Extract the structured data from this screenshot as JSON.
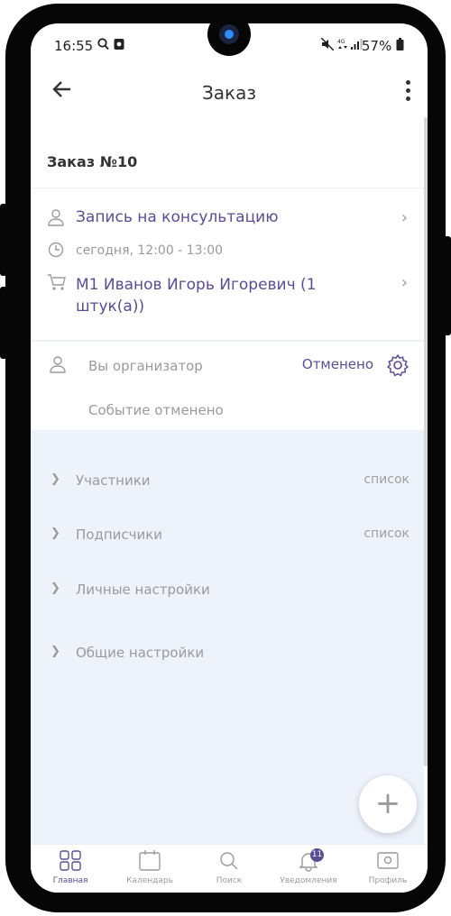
{
  "status_bar": {
    "time": "16:55",
    "battery": "57%"
  },
  "appbar": {
    "title": "Заказ"
  },
  "order": {
    "title": "Заказ №10",
    "event_name": "Запись на консультацию",
    "time": "сегодня, 12:00 - 13:00",
    "item": "М1 Иванов Игорь Игоревич (1 штук(а))"
  },
  "status": {
    "role": "Вы организатор",
    "state": "Отменено",
    "message": "Событие отменено"
  },
  "sections": [
    {
      "label": "Участники",
      "value": "список"
    },
    {
      "label": "Подписчики",
      "value": "список"
    },
    {
      "label": "Личные настройки",
      "value": ""
    },
    {
      "label": "Общие настройки",
      "value": ""
    }
  ],
  "bottom_nav": [
    {
      "label": "Главная",
      "icon": "grid-icon"
    },
    {
      "label": "Календарь",
      "icon": "calendar-icon"
    },
    {
      "label": "Поиск",
      "icon": "search-icon"
    },
    {
      "label": "Уведомления",
      "icon": "bell-icon",
      "badge": "11"
    },
    {
      "label": "Профиль",
      "icon": "profile-icon"
    }
  ],
  "colors": {
    "accent": "#5a4e92",
    "muted": "#9a9a9a",
    "content_bg": "#eef2fb"
  }
}
